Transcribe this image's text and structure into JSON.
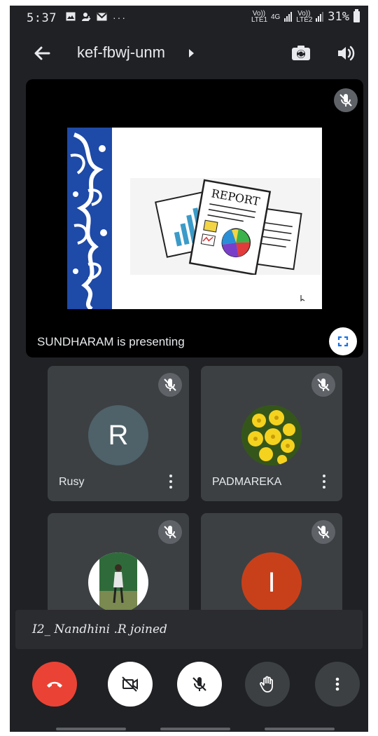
{
  "status_bar": {
    "time": "5:37",
    "left_icons": [
      "image-icon",
      "person-download-icon",
      "gmail-icon",
      "more-dots-icon"
    ],
    "network_1": "Vo)) LTE1",
    "network_gen": "4G",
    "network_2": "Vo)) LTE2",
    "battery": "31%"
  },
  "header": {
    "meeting_code": "kef-fbwj-unm"
  },
  "presentation": {
    "slide_heading": "REPORT",
    "presenting_text": "SUNDHARAM is presenting"
  },
  "participants": [
    {
      "name": "Rusy",
      "initial": "R",
      "avatar_color": "#4f6169",
      "muted": true
    },
    {
      "name": "PADMAREKA",
      "initial": "",
      "avatar_color": "#e9c41f",
      "muted": true
    },
    {
      "name": "",
      "initial": "",
      "avatar_color": "#2f6b3a",
      "muted": true
    },
    {
      "name": "",
      "initial": "I",
      "avatar_color": "#c8401a",
      "muted": true
    }
  ],
  "toast": {
    "text": "I2_ Nandhini .R joined"
  },
  "controls": {
    "end_call_color": "#ea4335",
    "buttons": [
      "end-call",
      "camera-off",
      "mic-off",
      "raise-hand",
      "more-options"
    ]
  }
}
